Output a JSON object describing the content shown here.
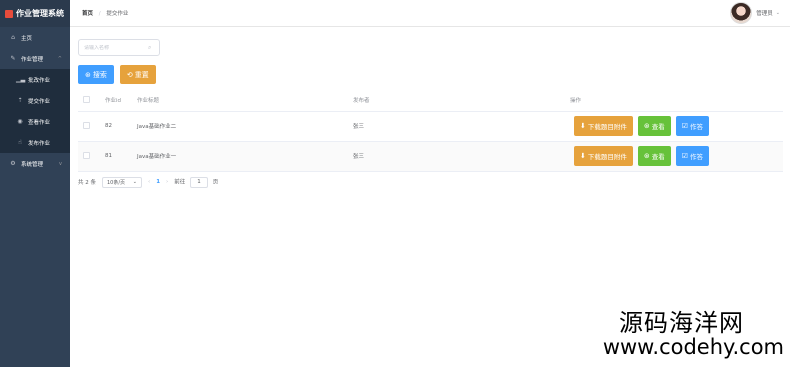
{
  "app": {
    "title": "作业管理系统"
  },
  "sidebar": {
    "items": [
      {
        "label": "主页",
        "icon": "home-icon"
      },
      {
        "label": "作业管理",
        "icon": "edit-icon",
        "expanded": true,
        "children": [
          {
            "label": "批改作业",
            "icon": "chart-icon"
          },
          {
            "label": "提交作业",
            "icon": "upload-icon"
          },
          {
            "label": "查看作业",
            "icon": "eye-icon"
          },
          {
            "label": "发布作业",
            "icon": "hand-icon"
          }
        ]
      },
      {
        "label": "系统管理",
        "icon": "gear-icon",
        "expanded": false
      }
    ]
  },
  "header": {
    "breadcrumb": {
      "home": "首页",
      "separator": "/",
      "current": "提交作业"
    },
    "user": {
      "name": "管理员"
    }
  },
  "search": {
    "placeholder": "请输入名称"
  },
  "toolbar": {
    "search_label": "搜索",
    "reset_label": "重置"
  },
  "table": {
    "columns": [
      "作业id",
      "作业标题",
      "发布者",
      "操作"
    ],
    "rows": [
      {
        "id": "82",
        "title": "Java基础作业二",
        "publisher": "张三"
      },
      {
        "id": "81",
        "title": "Java基础作业一",
        "publisher": "张三"
      }
    ],
    "row_actions": {
      "download": "下载题目附件",
      "view": "查看",
      "answer": "作答"
    }
  },
  "pagination": {
    "total": "共 2 条",
    "page_size": "10条/页",
    "current_page": "1",
    "goto_prefix": "前往",
    "goto_value": "1",
    "goto_suffix": "页"
  },
  "watermark": {
    "line1": "源码海洋网",
    "line2": "www.codehy.com"
  },
  "colors": {
    "sidebar": "#304156",
    "primary": "#409eff",
    "warning": "#e6a23c",
    "success": "#67c23a"
  }
}
